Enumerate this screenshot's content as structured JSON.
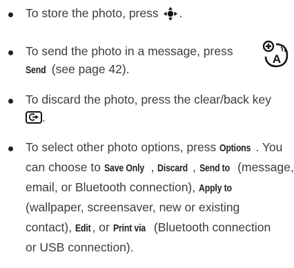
{
  "items": [
    {
      "lines": [
        {
          "before": "To store the photo, press ",
          "after": "."
        }
      ]
    },
    {
      "l1": "To send the photo in a message, press",
      "key": "Send",
      "l2after": " (see page 42)."
    },
    {
      "l1": "To discard the photo, press the clear/back key",
      "l2after": "."
    },
    {
      "l1_before": "To select other photo options, press ",
      "l1_key": "Options",
      "l1_after": ". You",
      "l2_before": "can choose to ",
      "k_save": "Save Only",
      "sep1": ", ",
      "k_discard": "Discard",
      "sep2": ", ",
      "k_sendto": "Send to",
      "l2_after": " (message,",
      "l3": "email, or Bluetooth connection), ",
      "k_apply": "Apply to",
      "l4": "(wallpaper, screensaver, new or existing",
      "l5_before": "contact), ",
      "k_edit": "Edit",
      "l5_mid": ", or ",
      "k_print": "Print via",
      "l5_after": " (Bluetooth connection",
      "l6": "or USB connection)."
    }
  ],
  "icons": {
    "nav": "navigation-key-icon",
    "clear": "clear-back-key-icon",
    "ptt": "network-feature-icon",
    "ptt_label": "A"
  }
}
